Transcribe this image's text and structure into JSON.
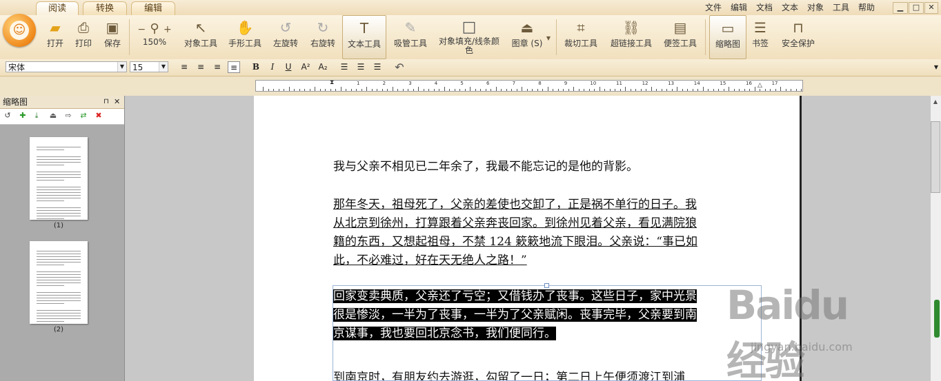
{
  "tabs": [
    {
      "label": "阅读",
      "active": true
    },
    {
      "label": "转换",
      "active": false
    },
    {
      "label": "编辑",
      "active": false
    }
  ],
  "menu": [
    "文件",
    "编辑",
    "文档",
    "文本",
    "对象",
    "工具",
    "帮助"
  ],
  "window_buttons": {
    "minimize": "▁",
    "maximize": "□",
    "close": "✕"
  },
  "toolbar": {
    "open": "打开",
    "print": "打印",
    "save": "保存",
    "zoom_value": "150%",
    "zoom_out": "−",
    "zoom_in": "+",
    "object_tool": "对象工具",
    "hand_tool": "手形工具",
    "rotate_left": "左旋转",
    "rotate_right": "右旋转",
    "text_tool": "文本工具",
    "eyedropper": "吸管工具",
    "fill_color": "对象填充/线条颜色",
    "stamp": "图章 (S)",
    "crop": "裁切工具",
    "hyperlink": "超链接工具",
    "note": "便签工具",
    "thumbnail": "缩略图",
    "bookmark": "书签",
    "security": "安全保护"
  },
  "format": {
    "font": "宋体",
    "size": "15",
    "bold": "B",
    "italic": "I",
    "underline": "U",
    "superscript": "A²",
    "subscript": "A₂"
  },
  "ruler_labels": [
    "1",
    "2",
    "3",
    "4",
    "5",
    "6",
    "7",
    "8",
    "9",
    "10",
    "11",
    "12",
    "13",
    "14",
    "15",
    "16",
    "17"
  ],
  "thumb_panel": {
    "title": "缩略图",
    "pin": "⊓",
    "close": "✕",
    "pages": [
      "(1)",
      "(2)"
    ]
  },
  "document": {
    "p1": "我与父亲不相见已二年余了，我最不能忘记的是他的背影。",
    "p2_lines": [
      "那年冬天，祖母死了，父亲的差使也交卸了，正是祸不单行的日子。我",
      "从北京到徐州，打算跟着父亲奔丧回家。到徐州见着父亲，看见满院狼",
      "籍的东西，又想起祖母，不禁 124 簌簌地流下眼泪。父亲说：“事已如",
      "此，不必难过，好在天无绝人之路！”"
    ],
    "p3_lines": [
      "回家变卖典质，父亲还了亏空；又借钱办了丧事。这些日子，家中光景",
      "很是惨淡，一半为了丧事，一半为了父亲赋闲。丧事完毕，父亲要到南",
      "京谋事，我也要回北京念书，我们便同行。"
    ],
    "p4": "到南京时，有朋友约去游逛，勾留了一日；第二日上午便须渡江到浦"
  },
  "watermark": {
    "brand": "Baidu经验",
    "url": "jingyan.baidu.com"
  }
}
